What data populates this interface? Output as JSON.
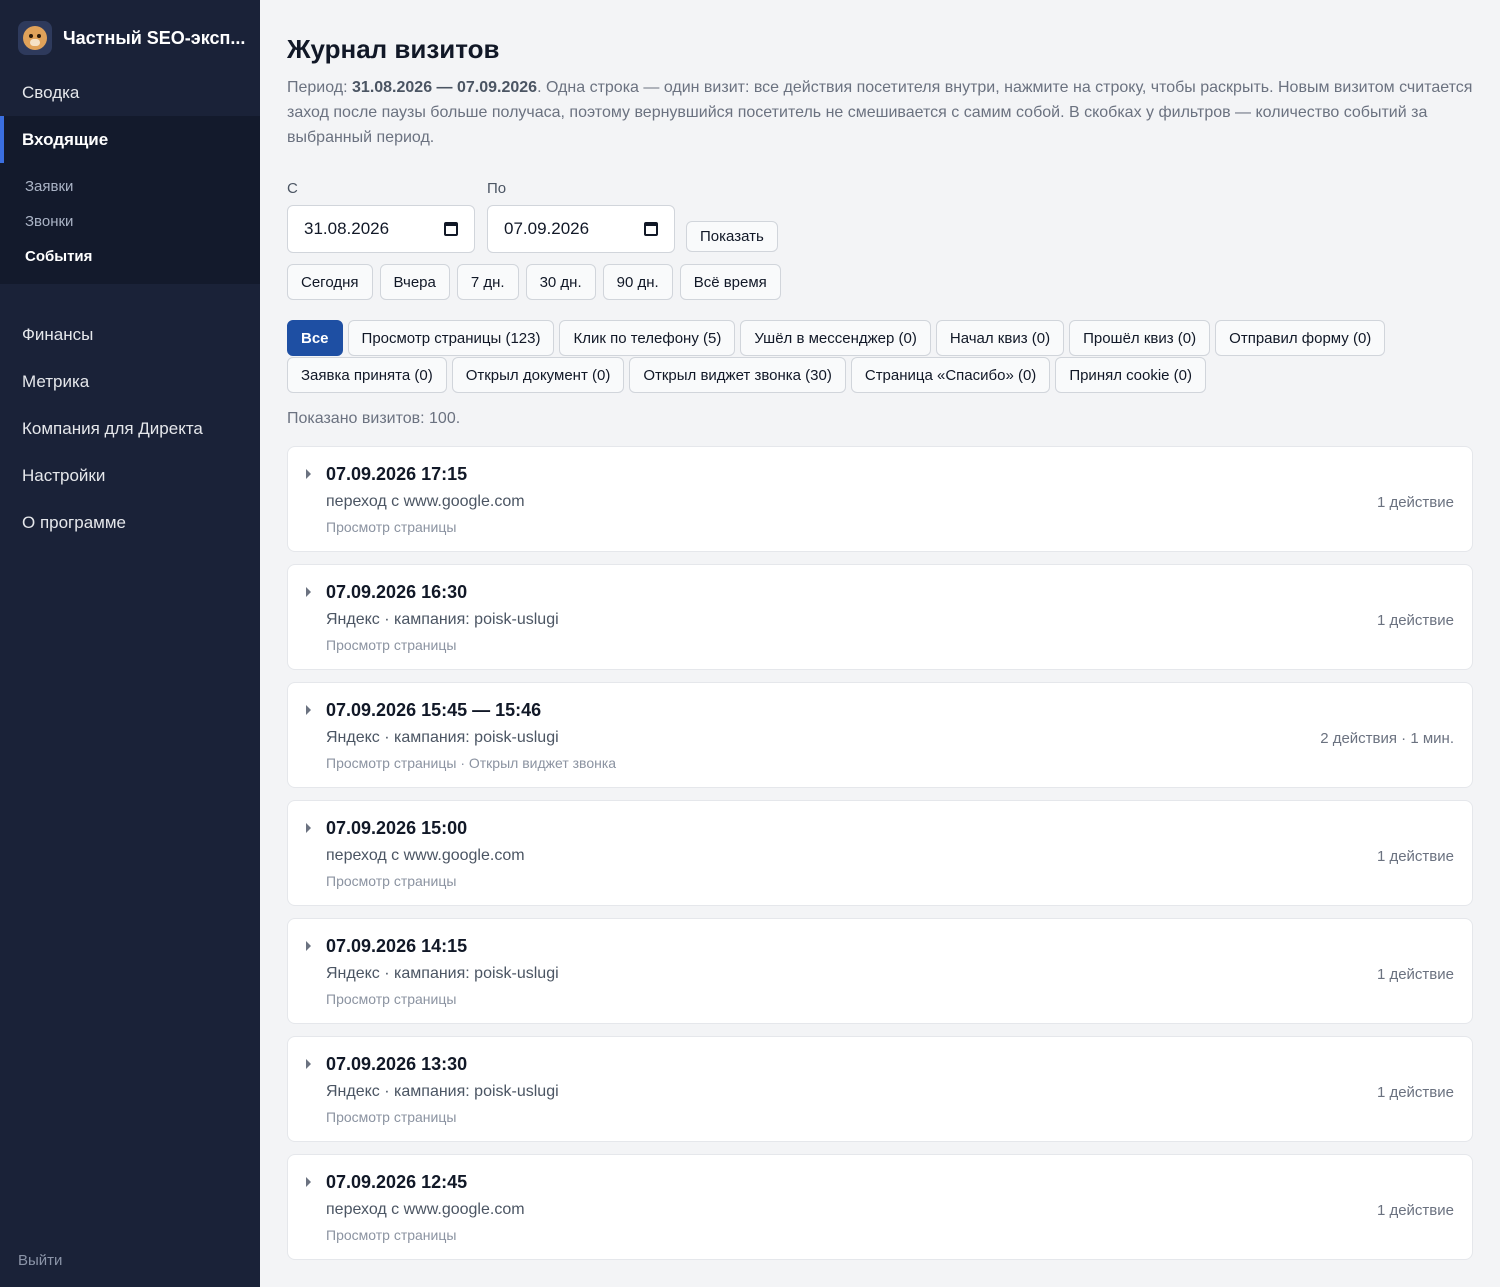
{
  "app": {
    "brand_name": "Частный SEO-эксп...",
    "logo_icon": "dog-avatar-icon"
  },
  "sidebar": {
    "items": [
      {
        "label": "Сводка"
      },
      {
        "label": "Входящие"
      }
    ],
    "sub_items": [
      {
        "label": "Заявки"
      },
      {
        "label": "Звонки"
      },
      {
        "label": "События"
      }
    ],
    "lower_items": [
      {
        "label": "Финансы"
      },
      {
        "label": "Метрика"
      },
      {
        "label": "Компания для Директа"
      },
      {
        "label": "Настройки"
      },
      {
        "label": "О программе"
      }
    ],
    "logout_label": "Выйти"
  },
  "page": {
    "title": "Журнал визитов",
    "intro_prefix": "Период: ",
    "intro_period": "31.08.2026 — 07.09.2026",
    "intro_text": ". Одна строка — один визит: все действия посетителя внутри, нажмите на строку, чтобы раскрыть. Новым визитом считается заход после паузы больше получаса, поэтому вернувшийся посетитель не смешивается с самим собой. В скобках у фильтров — количество событий за выбранный период."
  },
  "date_filter": {
    "from_label": "С",
    "from_value": "31.08.2026",
    "to_label": "По",
    "to_value": "07.09.2026",
    "show_button": "Показать",
    "presets": [
      {
        "label": "Сегодня"
      },
      {
        "label": "Вчера"
      },
      {
        "label": "7 дн."
      },
      {
        "label": "30 дн."
      },
      {
        "label": "90 дн."
      },
      {
        "label": "Всё время"
      }
    ]
  },
  "event_filters": [
    {
      "label": "Все",
      "active": true
    },
    {
      "label": "Просмотр страницы (123)"
    },
    {
      "label": "Клик по телефону (5)"
    },
    {
      "label": "Ушёл в мессенджер (0)"
    },
    {
      "label": "Начал квиз (0)"
    },
    {
      "label": "Прошёл квиз (0)"
    },
    {
      "label": "Отправил форму (0)"
    },
    {
      "label": "Заявка принята (0)"
    },
    {
      "label": "Открыл документ (0)"
    },
    {
      "label": "Открыл виджет звонка (30)"
    },
    {
      "label": "Страница «Спасибо» (0)"
    },
    {
      "label": "Принял cookie (0)"
    }
  ],
  "shown_count": "Показано визитов: 100.",
  "visits": [
    {
      "time": "07.09.2026 17:15",
      "source": "переход с www.google.com",
      "events": "Просмотр страницы",
      "count": "1 действие"
    },
    {
      "time": "07.09.2026 16:30",
      "source": "Яндекс · кампания: poisk-uslugi",
      "events": "Просмотр страницы",
      "count": "1 действие"
    },
    {
      "time": "07.09.2026 15:45 — 15:46",
      "source": "Яндекс · кампания: poisk-uslugi",
      "events": "Просмотр страницы · Открыл виджет звонка",
      "count": "2 действия · 1 мин."
    },
    {
      "time": "07.09.2026 15:00",
      "source": "переход с www.google.com",
      "events": "Просмотр страницы",
      "count": "1 действие"
    },
    {
      "time": "07.09.2026 14:15",
      "source": "Яндекс · кампания: poisk-uslugi",
      "events": "Просмотр страницы",
      "count": "1 действие"
    },
    {
      "time": "07.09.2026 13:30",
      "source": "Яндекс · кампания: poisk-uslugi",
      "events": "Просмотр страницы",
      "count": "1 действие"
    },
    {
      "time": "07.09.2026 12:45",
      "source": "переход с www.google.com",
      "events": "Просмотр страницы",
      "count": "1 действие"
    }
  ]
}
